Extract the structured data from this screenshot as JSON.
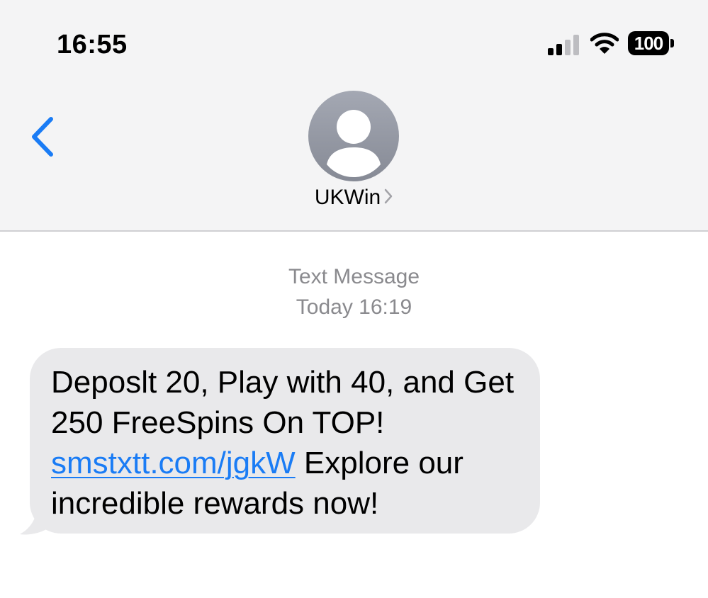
{
  "status_bar": {
    "time": "16:55",
    "battery_level": "100",
    "signal_bars_active": 2,
    "signal_bars_total": 4
  },
  "nav": {
    "back_icon": "chevron-left-icon",
    "contact_name": "UKWin",
    "contact_chevron_icon": "chevron-right-icon",
    "avatar_icon": "person-silhouette-icon"
  },
  "thread": {
    "label": "Text Message",
    "timestamp": "Today 16:19",
    "message": {
      "text_before_link": "Deposlt 20, Play with 40, and Get 250 FreeSpins On TOP! ",
      "link": "smstxtt.com/jgkW",
      "text_after_link": " Explore our incredible rewards now!"
    }
  },
  "colors": {
    "header_bg": "#f4f4f5",
    "accent_blue": "#1a7cf5",
    "bubble_bg": "#e9e9eb",
    "meta_gray": "#8a8a8e"
  }
}
